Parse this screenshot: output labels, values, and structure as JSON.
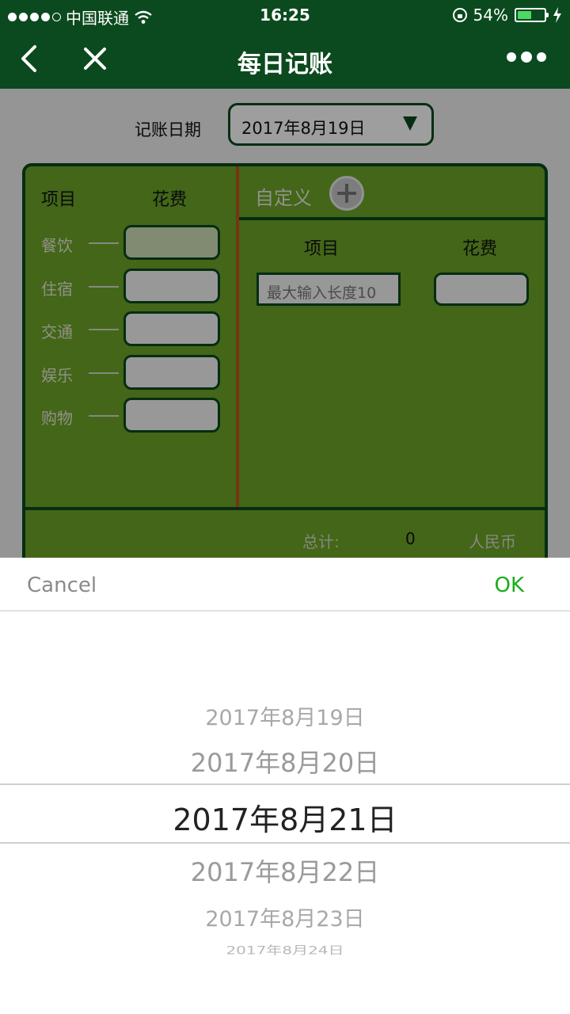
{
  "status_bar": {
    "carrier": "中国联通",
    "time": "16:25",
    "battery_percent": "54%",
    "battery_level": 0.54,
    "signal_dots_filled": 4,
    "icons": [
      "signal-dots-icon",
      "wifi-icon",
      "orientation-lock-icon",
      "battery-icon",
      "charging-bolt-icon"
    ]
  },
  "nav": {
    "title": "每日记账",
    "back_icon": "chevron-left-icon",
    "close_icon": "close-icon",
    "more_icon": "more-dots-icon"
  },
  "form": {
    "date_label": "记账日期",
    "date_value": "2017年8月19日",
    "preset": {
      "header_item": "项目",
      "header_cost": "花费",
      "rows": [
        {
          "label": "餐饮",
          "value": ""
        },
        {
          "label": "住宿",
          "value": ""
        },
        {
          "label": "交通",
          "value": ""
        },
        {
          "label": "娱乐",
          "value": ""
        },
        {
          "label": "购物",
          "value": ""
        }
      ]
    },
    "custom": {
      "label": "自定义",
      "add_icon": "plus-circle-icon",
      "header_item": "项目",
      "header_cost": "花费",
      "name_placeholder": "最大输入长度10",
      "cost_value": ""
    },
    "total": {
      "label": "总计:",
      "value": "0",
      "unit": "人民币"
    }
  },
  "picker": {
    "cancel_label": "Cancel",
    "ok_label": "OK",
    "options": [
      "2017年8月19日",
      "2017年8月20日",
      "2017年8月21日",
      "2017年8月22日",
      "2017年8月23日",
      "2017年8月24日"
    ],
    "selected": "2017年8月21日"
  },
  "colors": {
    "header_bg": "#0b4a1e",
    "board_bg": "#6da528",
    "divider_accent": "#c0541a",
    "ok_green": "#1aad19"
  }
}
